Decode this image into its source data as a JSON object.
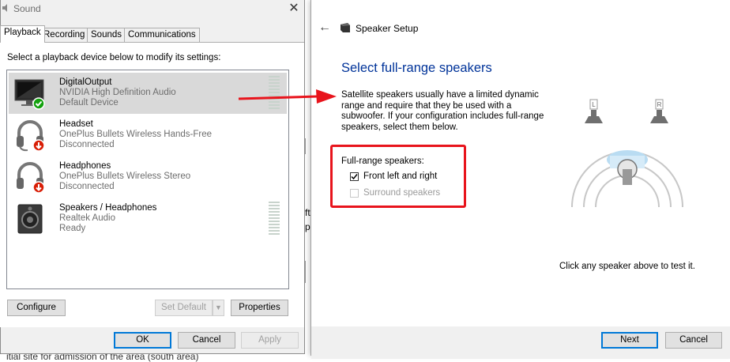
{
  "background": {
    "bottom_text": "itial site for admission of the area (south area)",
    "fragment_1": "ft",
    "fragment_2": "p"
  },
  "sound_dialog": {
    "title": "Sound",
    "close_glyph": "✕",
    "tabs": [
      "Playback",
      "Recording",
      "Sounds",
      "Communications"
    ],
    "instruction": "Select a playback device below to modify its settings:",
    "devices": [
      {
        "name": "DigitalOutput",
        "driver": "NVIDIA High Definition Audio",
        "status": "Default Device",
        "selected": true,
        "icon": "monitor-icon",
        "badge": "check-badge-icon"
      },
      {
        "name": "Headset",
        "driver": "OnePlus Bullets Wireless Hands-Free",
        "status": "Disconnected",
        "selected": false,
        "icon": "headset-icon",
        "badge": "down-arrow-badge-icon"
      },
      {
        "name": "Headphones",
        "driver": "OnePlus Bullets Wireless Stereo",
        "status": "Disconnected",
        "selected": false,
        "icon": "headphones-icon",
        "badge": "down-arrow-badge-icon"
      },
      {
        "name": "Speakers / Headphones",
        "driver": "Realtek Audio",
        "status": "Ready",
        "selected": false,
        "icon": "speaker-icon",
        "badge": ""
      }
    ],
    "buttons": {
      "configure": "Configure",
      "set_default": "Set Default",
      "properties": "Properties",
      "ok": "OK",
      "cancel": "Cancel",
      "apply": "Apply"
    }
  },
  "speaker_setup": {
    "back_glyph": "←",
    "title": "Speaker Setup",
    "heading": "Select full-range speakers",
    "description": "Satellite speakers usually have a limited dynamic range and require that they be used with a subwoofer.  If your configuration includes full-range speakers, select them below.",
    "group_label": "Full-range speakers:",
    "options": [
      {
        "label": "Front left and right",
        "checked": true,
        "enabled": true
      },
      {
        "label": "Surround speakers",
        "checked": false,
        "enabled": false
      }
    ],
    "speaker_labels": {
      "left": "L",
      "right": "R"
    },
    "hint": "Click any speaker above to test it.",
    "buttons": {
      "next": "Next",
      "cancel": "Cancel"
    }
  },
  "colors": {
    "annotation_red": "#e8141c",
    "heading_blue": "#003399",
    "check_green": "#13a10e",
    "badge_red": "#d81e06"
  }
}
